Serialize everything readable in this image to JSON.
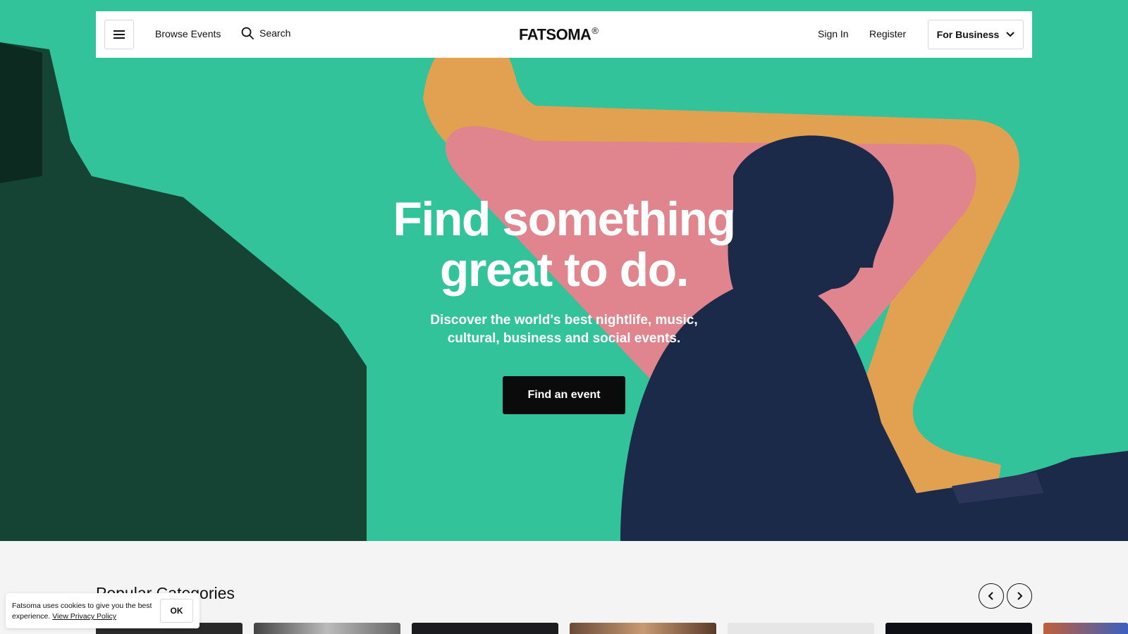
{
  "nav": {
    "browse_label": "Browse Events",
    "search_label": "Search",
    "logo_text": "FATSOMA",
    "logo_mark": "®",
    "signin_label": "Sign In",
    "register_label": "Register",
    "business_label": "For Business"
  },
  "hero": {
    "title_line1": "Find something",
    "title_line2": "great to do.",
    "subtitle_line1": "Discover the world's best nightlife, music,",
    "subtitle_line2": "cultural, business and social events.",
    "cta_label": "Find an event"
  },
  "categories": {
    "title": "Popular Categories",
    "prev_icon": "chevron-left-icon",
    "next_icon": "chevron-right-icon"
  },
  "cookie": {
    "text": "Fatsoma uses cookies to give you the best experience.",
    "link_label": "View Privacy Policy",
    "ok_label": "OK"
  },
  "colors": {
    "hero_bg": "#34c49c",
    "cta_bg": "#0b0b0b",
    "accent_orange": "#f0a24a",
    "accent_pink": "#e08a8f"
  },
  "icons": {
    "menu": "hamburger-menu-icon",
    "search": "search-icon",
    "business_dropdown": "chevron-down-icon"
  }
}
